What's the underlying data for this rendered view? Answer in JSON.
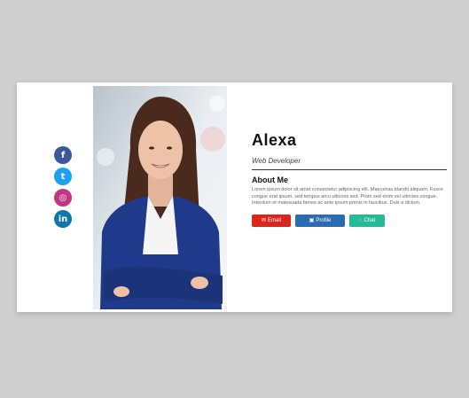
{
  "profile": {
    "name": "Alexa",
    "role": "Web Developer",
    "about_title": "About Me",
    "about_text": "Lorem ipsum dolor sit amet consectetur adipiscing elit. Maecenas blandit aliquam. Fusce congue erat ipsum, sed tempus arcu ultricies sed. Proin sed enim vel ultricies congue. Interdum et malesuada fames ac ante ipsum primis in faucibus. Duis a dictum."
  },
  "social": [
    {
      "icon": "facebook-icon",
      "glyph": "f",
      "color": "#3b5998"
    },
    {
      "icon": "twitter-icon",
      "glyph": "t",
      "color": "#1da1f2"
    },
    {
      "icon": "instagram-icon",
      "glyph": "◎",
      "color": "#c13584"
    },
    {
      "icon": "linkedin-icon",
      "glyph": "in",
      "color": "#0e76a8"
    }
  ],
  "actions": {
    "email_label": "Email",
    "email_color": "#d9261c",
    "profile_label": "Profile",
    "profile_color": "#2b6cb0",
    "chat_label": "Chat",
    "chat_color": "#25b99a"
  }
}
